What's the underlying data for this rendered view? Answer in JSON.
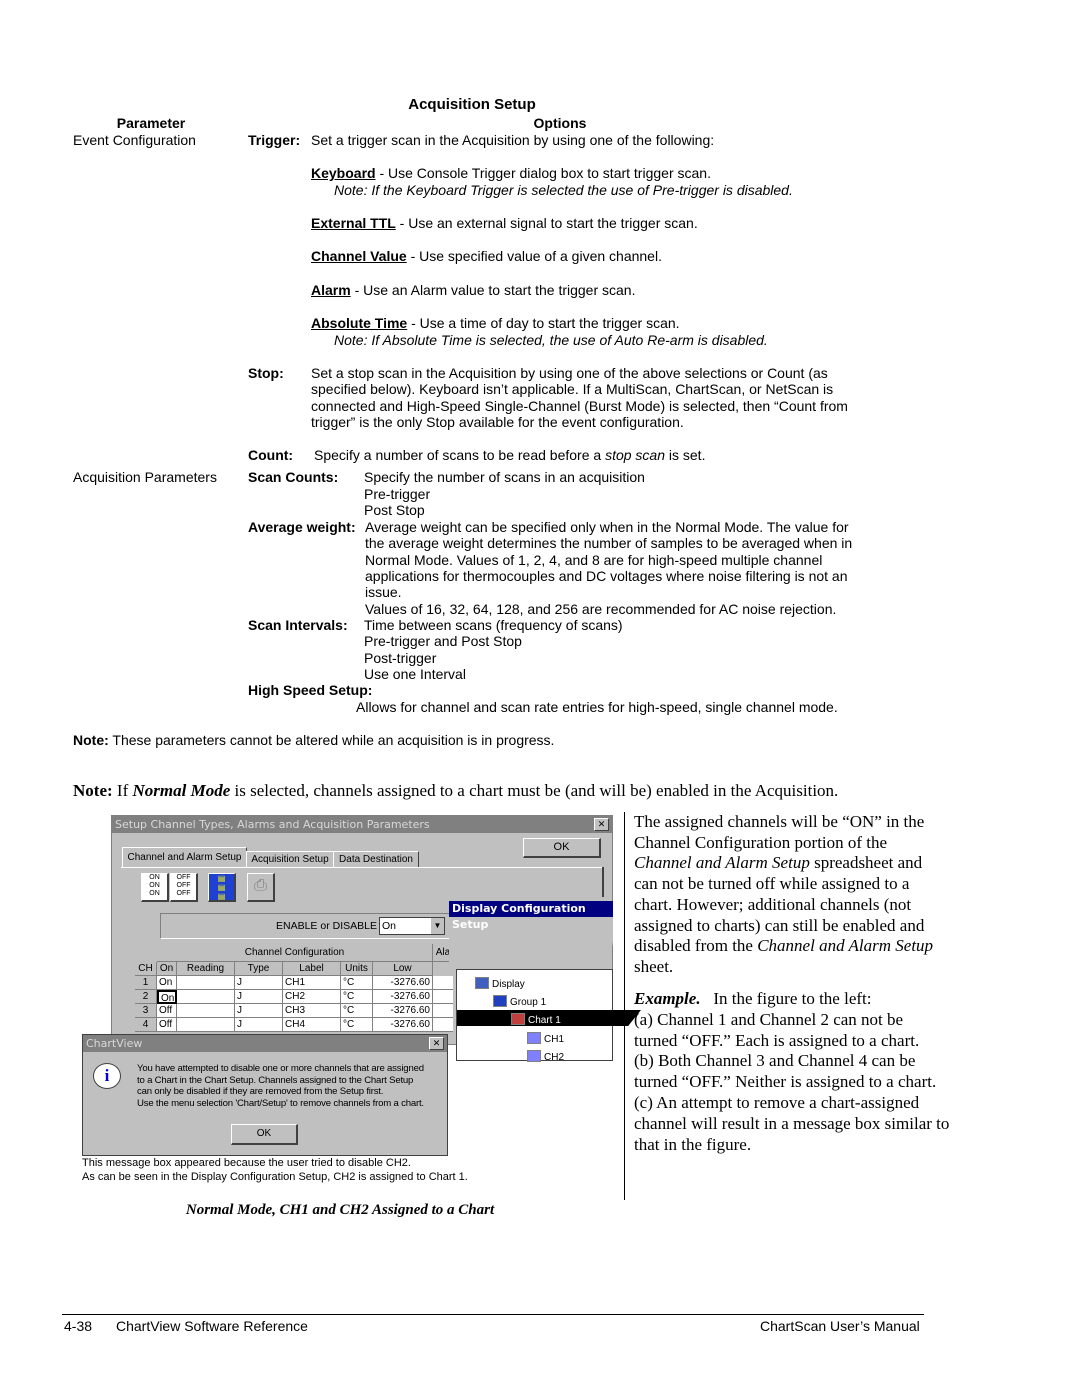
{
  "title": "Acquisition Setup",
  "headers": {
    "parameter": "Parameter",
    "options": "Options"
  },
  "event": {
    "param": "Event Configuration",
    "trigger_label": "Trigger:",
    "trigger_text": "Set a trigger scan in the Acquisition by using one of the following:",
    "options": [
      {
        "term": "Keyboard",
        "text": " - Use Console Trigger dialog box to start trigger scan.",
        "note": "Note:  If the Keyboard Trigger is selected the use of Pre-trigger is disabled."
      },
      {
        "term": "External TTL",
        "text": " - Use an external signal to start the trigger scan."
      },
      {
        "term": "Channel Value",
        "text": " - Use specified value of a given channel."
      },
      {
        "term": "Alarm",
        "text": " - Use an Alarm value to start the trigger scan."
      },
      {
        "term": "Absolute Time",
        "text": " - Use a time of day to start the trigger scan.",
        "note": "Note:  If Absolute Time is selected, the use of Auto Re-arm is disabled."
      }
    ],
    "stop_label": "Stop:",
    "stop_lines": [
      "Set a stop scan in the Acquisition by using one of the above selections or Count (as",
      "specified below).  Keyboard isn’t applicable.  If a MultiScan, ChartScan, or NetScan is",
      "connected and High-Speed Single-Channel (Burst Mode) is selected, then “Count from",
      "trigger” is the only Stop available for the event configuration."
    ],
    "count_label": "Count:",
    "count_pre": "Specify a number of scans to be read before a ",
    "count_em": "stop scan",
    "count_post": " is set."
  },
  "acq": {
    "param": "Acquisition Parameters",
    "scan_counts_label": "Scan Counts:",
    "scan_counts_lines": [
      "Specify the number of scans in an acquisition",
      "Pre-trigger",
      "Post Stop"
    ],
    "avg_label": "Average weight:",
    "avg_lines": [
      "Average weight can be specified only when in the Normal Mode.  The  value for",
      "the average weight determines the number of samples to be averaged when in",
      "Normal Mode.  Values of 1, 2, 4, and 8 are for high-speed multiple channel",
      "applications for thermocouples and DC voltages where noise filtering is not an",
      "issue.",
      "Values of 16, 32, 64, 128, and 256 are recommended for AC noise rejection."
    ],
    "intervals_label": "Scan Intervals:",
    "intervals_lines": [
      "Time between scans (frequency of scans)",
      "Pre-trigger and Post Stop",
      "Post-trigger",
      "Use one Interval"
    ],
    "hs_label": "High Speed Setup:",
    "hs_text": "Allows for channel and scan rate entries for high-speed, single channel mode."
  },
  "note1": {
    "label": "Note:",
    "text": "These parameters cannot be altered while an acquisition is in progress."
  },
  "note2": {
    "label": "Note:",
    "pre": " If ",
    "em": "Normal Mode",
    "post": " is selected, channels assigned to a chart must be (and will be) enabled in the Acquisition."
  },
  "screenshot": {
    "main_title": "Setup Channel Types, Alarms and Acquisition Parameters",
    "ok": "OK",
    "tabs": [
      "Channel and Alarm Setup",
      "Acquisition Setup",
      "Data Destination"
    ],
    "enable_label": "ENABLE or DISABLE",
    "enable_value": "On",
    "group_headers": [
      "Channel Configuration",
      "Ala"
    ],
    "columns": [
      "CH",
      "On",
      "Reading",
      "Type",
      "Label",
      "Units",
      "Low"
    ],
    "rows": [
      [
        "1",
        "On",
        "",
        "J",
        "CH1",
        "°C",
        "-3276.60"
      ],
      [
        "2",
        "On",
        "",
        "J",
        "CH2",
        "°C",
        "-3276.60"
      ],
      [
        "3",
        "Off",
        "",
        "J",
        "CH3",
        "°C",
        "-3276.60"
      ],
      [
        "4",
        "Off",
        "",
        "J",
        "CH4",
        "°C",
        "-3276.60"
      ]
    ],
    "display_title": "Display Configuration  Setup",
    "tree": [
      "Display",
      "Group 1",
      "Chart 1",
      "CH1",
      "CH2"
    ],
    "msg_title": "ChartView",
    "msg_lines": [
      "You have attempted to disable one or more channels that are assigned",
      "to a Chart in the Chart Setup.  Channels assigned to the Chart Setup",
      "can only be disabled if they are removed from the Setup first.",
      "Use the menu selection 'Chart/Setup' to remove channels from a chart."
    ],
    "msg_ok": "OK",
    "captions": [
      "This message box appeared because the user tried to disable CH2.",
      "As can be seen in the Display Configuration Setup, CH2 is assigned to Chart 1."
    ],
    "accent": "#000080"
  },
  "right": {
    "p1": [
      {
        "t": "The assigned channels will be “ON” in the"
      },
      {
        "t": "Channel Configuration portion of the"
      },
      {
        "t": "Channel and Alarm Setup",
        "i": true,
        "t2": " spreadsheet and"
      },
      {
        "t": "can not be turned off while assigned to a"
      },
      {
        "t": "chart.  However; additional channels (not"
      },
      {
        "t": "assigned to charts) can still be enabled and"
      },
      {
        "t": "disabled from the ",
        "t2i": "Channel and Alarm Setup"
      },
      {
        "t": "sheet."
      }
    ],
    "example_label": "Example.",
    "example_first": "   In the figure to the left:",
    "p2": [
      "(a) Channel 1 and Channel 2 can not be",
      "turned “OFF.”   Each is assigned to a chart.",
      "(b) Both Channel 3 and Channel 4 can be",
      "turned “OFF.”  Neither is assigned to a chart.",
      "(c) An attempt to remove a chart-assigned",
      "channel will result in a message box similar to",
      "that in the figure."
    ]
  },
  "caption": "Normal Mode, CH1 and CH2 Assigned to a Chart",
  "footer": {
    "page": "4-38",
    "section": "ChartView Software Reference",
    "manual": "ChartScan User’s Manual"
  }
}
